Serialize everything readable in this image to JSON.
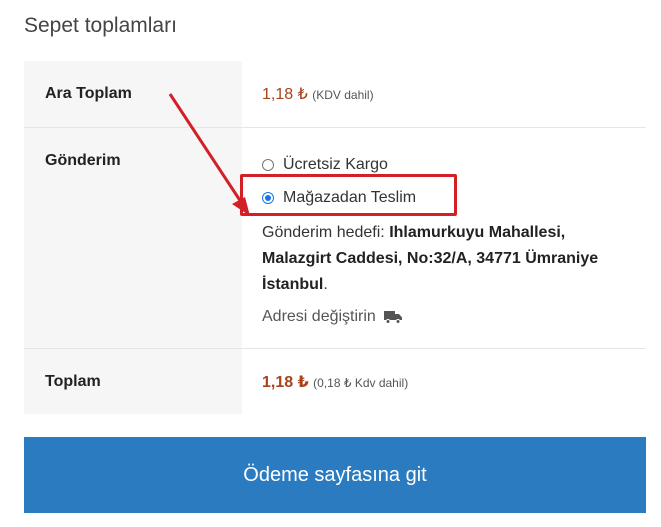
{
  "title": "Sepet toplamları",
  "subtotal": {
    "label": "Ara Toplam",
    "amount": "1,18 ₺",
    "tax_note": "(KDV dahil)"
  },
  "shipping": {
    "label": "Gönderim",
    "options": [
      {
        "label": "Ücretsiz Kargo",
        "selected": false
      },
      {
        "label": "Mağazadan Teslim",
        "selected": true
      }
    ],
    "destination_prefix": "Gönderim hedefi: ",
    "destination_address": "Ihlamurkuyu Mahallesi, Malazgirt Caddesi, No:32/A, 34771 Ümraniye İstanbul",
    "destination_suffix": ".",
    "change_address_label": "Adresi değiştirin"
  },
  "total": {
    "label": "Toplam",
    "amount": "1,18 ₺",
    "tax_note": "(0,18 ₺ Kdv dahil)"
  },
  "checkout_button": "Ödeme sayfasına git",
  "colors": {
    "price": "#a8431b",
    "button": "#2b7bc0",
    "annotation": "#d31f26"
  },
  "icons": [
    "truck-icon",
    "radio-icon"
  ]
}
